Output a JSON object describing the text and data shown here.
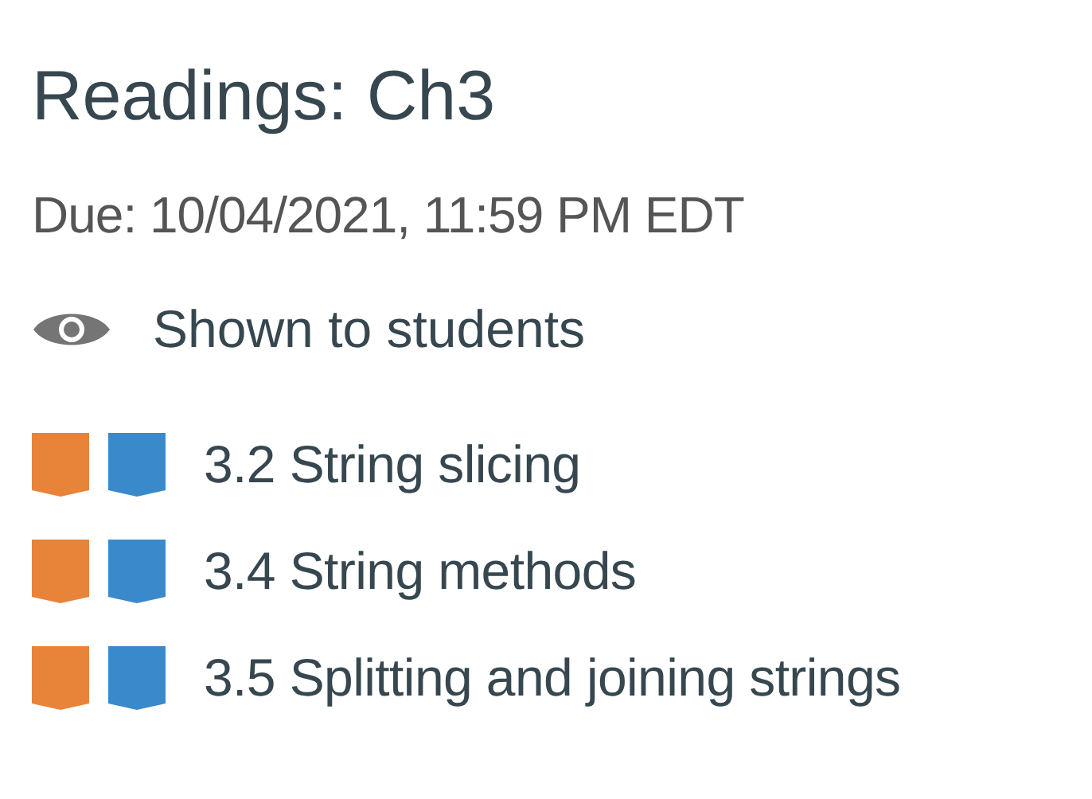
{
  "title": "Readings: Ch3",
  "due": "Due: 10/04/2021, 11:59 PM EDT",
  "visibility": {
    "label": "Shown to students",
    "shown": true
  },
  "sections": [
    {
      "label": "3.2 String slicing"
    },
    {
      "label": "3.4 String methods"
    },
    {
      "label": "3.5 Splitting and joining strings"
    }
  ]
}
